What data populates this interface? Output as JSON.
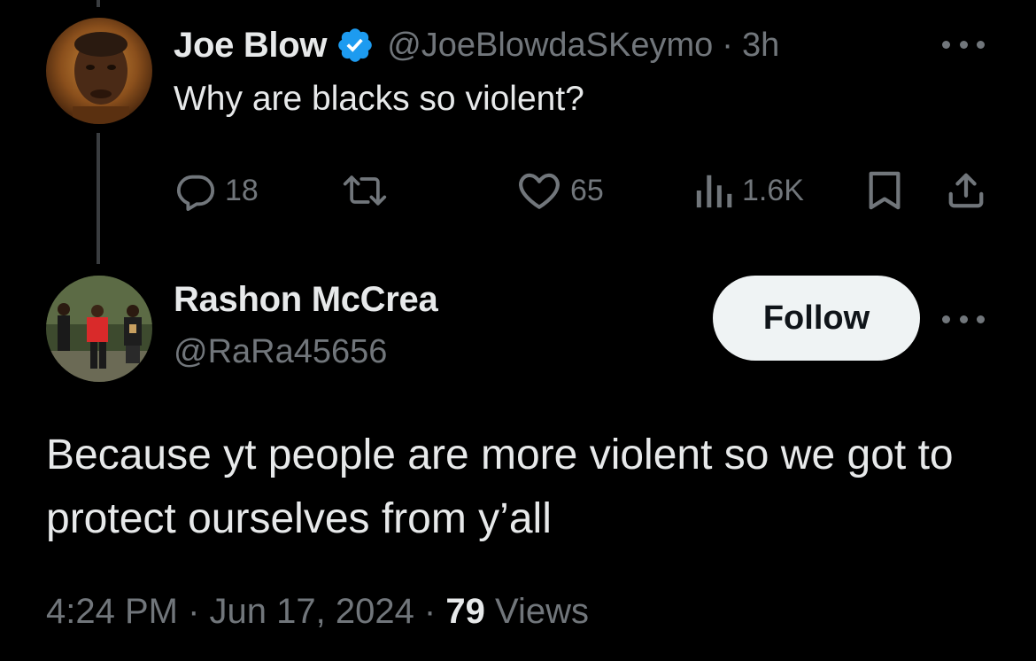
{
  "parent_tweet": {
    "author_name": "Joe Blow",
    "handle": "@JoeBlowdaSKeymo",
    "separator": "·",
    "time": "3h",
    "text": "Why are blacks so violent?",
    "reply_count": "18",
    "retweet_count": "",
    "like_count": "65",
    "view_count": "1.6K",
    "verified_color": "#1d9bf0"
  },
  "reply_tweet": {
    "author_name": "Rashon McCrea",
    "handle": "@RaRa45656",
    "follow_label": "Follow",
    "text": "Because yt people are more violent so we got to protect ourselves from y’all",
    "timestamp": "4:24 PM · Jun 17, 2024 · ",
    "views_count": "79",
    "views_label": " Views"
  },
  "colors": {
    "background": "#000000",
    "primary_text": "#e7e9ea",
    "secondary_text": "#71767b",
    "follow_bg": "#eff3f4"
  },
  "icons": [
    "reply-icon",
    "retweet-icon",
    "like-icon",
    "views-icon",
    "bookmark-icon",
    "share-icon",
    "more-icon",
    "verified-icon"
  ]
}
